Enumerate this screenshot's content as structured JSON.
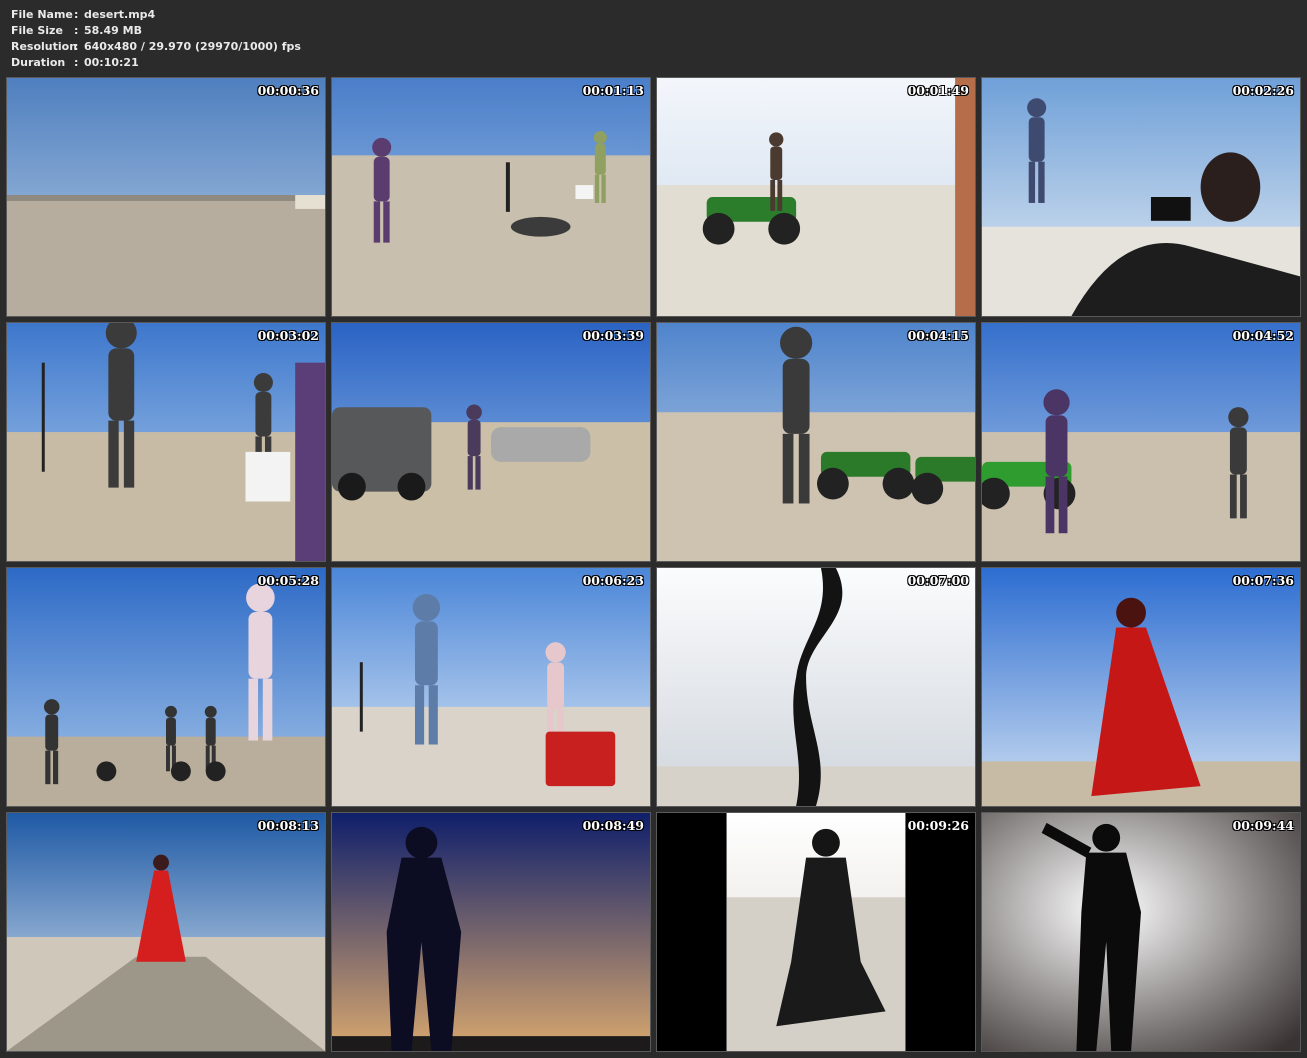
{
  "info": {
    "file_name_label": "File Name",
    "file_name": "desert.mp4",
    "file_size_label": "File Size",
    "file_size": "58.49 MB",
    "resolution_label": "Resolution",
    "resolution": "640x480 / 29.970 (29970/1000) fps",
    "duration_label": "Duration",
    "duration": "00:10:21",
    "separator": ":"
  },
  "thumbnails": [
    {
      "timestamp": "00:00:36",
      "scene": "empty-desert"
    },
    {
      "timestamp": "00:01:13",
      "scene": "photographer-model"
    },
    {
      "timestamp": "00:01:49",
      "scene": "atv-rider"
    },
    {
      "timestamp": "00:02:26",
      "scene": "photographer-closeup"
    },
    {
      "timestamp": "00:03:02",
      "scene": "crew-walking"
    },
    {
      "timestamp": "00:03:39",
      "scene": "cars-model"
    },
    {
      "timestamp": "00:04:15",
      "scene": "atv-crew"
    },
    {
      "timestamp": "00:04:52",
      "scene": "model-atv"
    },
    {
      "timestamp": "00:05:28",
      "scene": "dirt-bikes"
    },
    {
      "timestamp": "00:06:23",
      "scene": "cooler-shoot"
    },
    {
      "timestamp": "00:07:00",
      "scene": "silhouette"
    },
    {
      "timestamp": "00:07:36",
      "scene": "red-dress"
    },
    {
      "timestamp": "00:08:13",
      "scene": "red-dress-wide"
    },
    {
      "timestamp": "00:08:49",
      "scene": "latex-dusk"
    },
    {
      "timestamp": "00:09:26",
      "scene": "kneeling"
    },
    {
      "timestamp": "00:09:44",
      "scene": "latex-studio"
    }
  ],
  "colors": {
    "background": "#2b2b2b",
    "text": "#e9e9e9",
    "timestamp": "#ffffff"
  }
}
